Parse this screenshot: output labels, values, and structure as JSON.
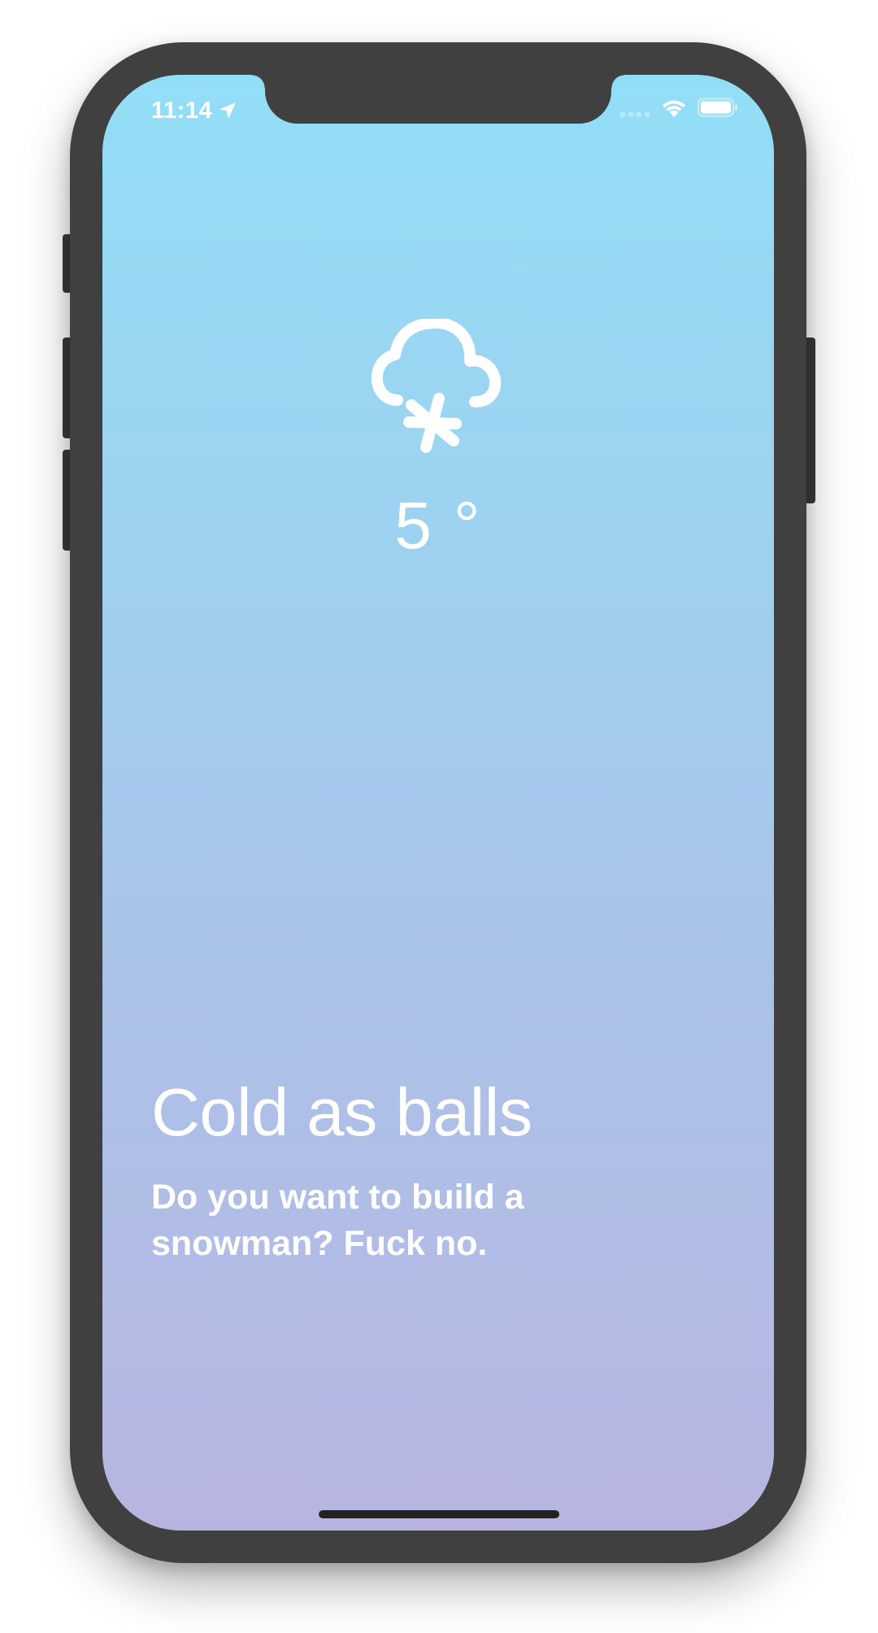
{
  "status_bar": {
    "time": "11:14",
    "location_icon": "location-arrow-icon",
    "signal_icon": "cellular-signal-icon",
    "wifi_icon": "wifi-icon",
    "battery_icon": "battery-icon"
  },
  "weather": {
    "icon": "cloud-snow-icon",
    "temperature": "5 °"
  },
  "message": {
    "headline": "Cold as balls",
    "subline": "Do you want to build a snowman? Fuck no."
  },
  "colors": {
    "gradient_top": "#93def7",
    "gradient_bottom": "#b7b5df",
    "device_frame": "#404040",
    "text": "#ffffff"
  }
}
